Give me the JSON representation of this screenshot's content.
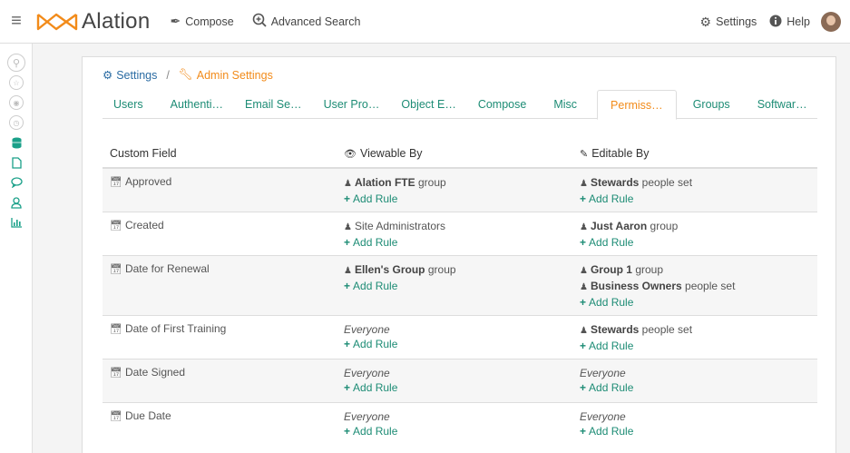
{
  "topbar": {
    "brand": "Alation",
    "compose": "Compose",
    "advanced_search": "Advanced Search",
    "settings": "Settings",
    "help": "Help"
  },
  "breadcrumb": {
    "settings": "Settings",
    "separator": "/",
    "admin": "Admin Settings"
  },
  "tabs": [
    {
      "label": "Users",
      "active": false
    },
    {
      "label": "Authenti…",
      "active": false
    },
    {
      "label": "Email Se…",
      "active": false
    },
    {
      "label": "User Pro…",
      "active": false
    },
    {
      "label": "Object E…",
      "active": false
    },
    {
      "label": "Compose",
      "active": false
    },
    {
      "label": "Misc",
      "active": false
    },
    {
      "label": "Permiss…",
      "active": true
    },
    {
      "label": "Groups",
      "active": false
    },
    {
      "label": "Softwar…",
      "active": false
    }
  ],
  "table": {
    "headers": {
      "field": "Custom Field",
      "viewable": "Viewable By",
      "editable": "Editable By"
    },
    "add_rule": "Add Rule",
    "rows": [
      {
        "field": "Approved",
        "viewable": [
          {
            "name": "Alation FTE",
            "suffix": "group"
          }
        ],
        "editable": [
          {
            "name": "Stewards",
            "suffix": "people set"
          }
        ]
      },
      {
        "field": "Created",
        "viewable": [
          {
            "plain": "Site Administrators"
          }
        ],
        "editable": [
          {
            "name": "Just Aaron",
            "suffix": "group"
          }
        ]
      },
      {
        "field": "Date for Renewal",
        "viewable": [
          {
            "name": "Ellen's Group",
            "suffix": "group"
          }
        ],
        "editable": [
          {
            "name": "Group 1",
            "suffix": "group"
          },
          {
            "name": "Business Owners",
            "suffix": "people set"
          }
        ]
      },
      {
        "field": "Date of First Training",
        "viewable_everyone": "Everyone",
        "editable": [
          {
            "name": "Stewards",
            "suffix": "people set"
          }
        ]
      },
      {
        "field": "Date Signed",
        "viewable_everyone": "Everyone",
        "editable_everyone": "Everyone"
      },
      {
        "field": "Due Date",
        "viewable_everyone": "Everyone",
        "editable_everyone": "Everyone"
      }
    ]
  },
  "colors": {
    "accent_green": "#1d8c75",
    "accent_orange": "#f28b1a",
    "link_blue": "#2b6ca3"
  },
  "icons": {
    "rail": [
      "search-icon",
      "star-icon",
      "eye-icon",
      "clock-icon",
      "database-icon",
      "document-icon",
      "comment-icon",
      "user-icon",
      "chart-icon"
    ]
  }
}
